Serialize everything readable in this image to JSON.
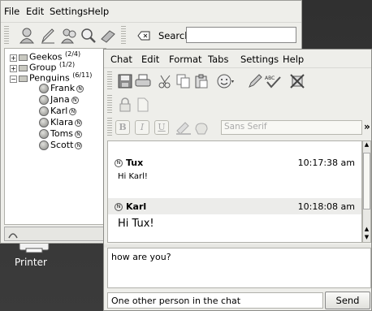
{
  "contact_list": {
    "menu": [
      {
        "label": "File"
      },
      {
        "label": "Edit"
      },
      {
        "label": "Settings"
      },
      {
        "label": "Help"
      }
    ],
    "search_label": "Search:",
    "search_value": "",
    "tree": [
      {
        "type": "group",
        "label": "Geekos",
        "count": "(2/4)",
        "expanded": false
      },
      {
        "type": "group",
        "label": "Group",
        "count": "(1/2)",
        "expanded": false
      },
      {
        "type": "group",
        "label": "Penguins",
        "count": "(6/11)",
        "expanded": true
      },
      {
        "type": "buddy",
        "label": "Frank"
      },
      {
        "type": "buddy",
        "label": "Jana"
      },
      {
        "type": "buddy",
        "label": "Karl"
      },
      {
        "type": "buddy",
        "label": "Klara"
      },
      {
        "type": "buddy",
        "label": "Toms"
      },
      {
        "type": "buddy",
        "label": "Scott"
      }
    ]
  },
  "desktop": {
    "printer_label": "Printer"
  },
  "chat": {
    "menu": [
      {
        "label": "Chat"
      },
      {
        "label": "Edit"
      },
      {
        "label": "Format"
      },
      {
        "label": "Tabs"
      },
      {
        "label": "Settings"
      },
      {
        "label": "Help"
      }
    ],
    "font_placeholder": "Sans Serif",
    "messages": [
      {
        "sender": "Tux",
        "time": "10:17:38 am",
        "text": "Hi Karl!"
      },
      {
        "sender": "Karl",
        "time": "10:18:08 am",
        "text": "Hi Tux!"
      }
    ],
    "input_text": "how are you?",
    "status_text": "One other person in the chat",
    "send_label": "Send"
  },
  "colors": {
    "desktop_bg": "#3a3a3a",
    "window_bg": "#eeeeea",
    "message_header_alt": "#ececea"
  }
}
